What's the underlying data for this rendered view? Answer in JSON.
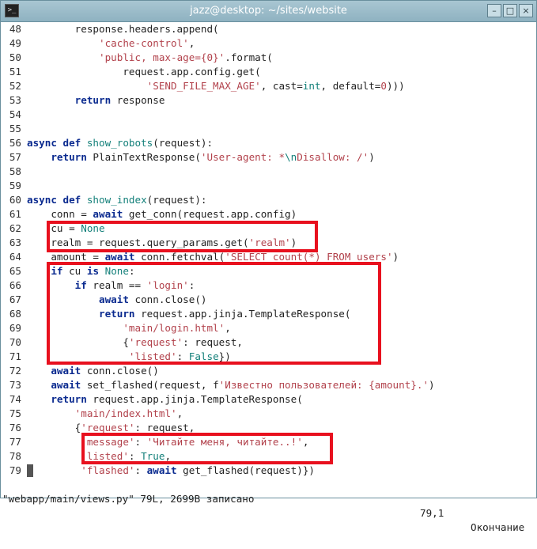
{
  "window": {
    "title": "jazz@desktop: ~/sites/website",
    "app_icon_text": ">_",
    "buttons": {
      "minimize": "–",
      "maximize": "□",
      "close": "×"
    }
  },
  "lines": [
    {
      "n": "48",
      "tokens": [
        {
          "t": "        response.headers.append("
        }
      ]
    },
    {
      "n": "49",
      "tokens": [
        {
          "t": "            "
        },
        {
          "t": "'cache-control'",
          "c": "str"
        },
        {
          "t": ","
        }
      ]
    },
    {
      "n": "50",
      "tokens": [
        {
          "t": "            "
        },
        {
          "t": "'public, max-age={0}'",
          "c": "str"
        },
        {
          "t": ".format("
        }
      ]
    },
    {
      "n": "51",
      "tokens": [
        {
          "t": "                request.app.config.get("
        }
      ]
    },
    {
      "n": "52",
      "tokens": [
        {
          "t": "                    "
        },
        {
          "t": "'SEND_FILE_MAX_AGE'",
          "c": "str"
        },
        {
          "t": ", cast="
        },
        {
          "t": "int",
          "c": "const"
        },
        {
          "t": ", default="
        },
        {
          "t": "0",
          "c": "str"
        },
        {
          "t": ")))"
        }
      ]
    },
    {
      "n": "53",
      "tokens": [
        {
          "t": "        "
        },
        {
          "t": "return",
          "c": "kw"
        },
        {
          "t": " response"
        }
      ]
    },
    {
      "n": "54",
      "tokens": []
    },
    {
      "n": "55",
      "tokens": []
    },
    {
      "n": "56",
      "tokens": [
        {
          "t": "async def",
          "c": "kw"
        },
        {
          "t": " "
        },
        {
          "t": "show_robots",
          "c": "fn"
        },
        {
          "t": "(request):"
        }
      ]
    },
    {
      "n": "57",
      "tokens": [
        {
          "t": "    "
        },
        {
          "t": "return",
          "c": "kw"
        },
        {
          "t": " PlainTextResponse("
        },
        {
          "t": "'User-agent: *",
          "c": "str"
        },
        {
          "t": "\\n",
          "c": "const"
        },
        {
          "t": "Disallow: /'",
          "c": "str"
        },
        {
          "t": ")"
        }
      ]
    },
    {
      "n": "58",
      "tokens": []
    },
    {
      "n": "59",
      "tokens": []
    },
    {
      "n": "60",
      "tokens": [
        {
          "t": "async def",
          "c": "kw"
        },
        {
          "t": " "
        },
        {
          "t": "show_index",
          "c": "fn"
        },
        {
          "t": "(request):"
        }
      ]
    },
    {
      "n": "61",
      "tokens": [
        {
          "t": "    conn = "
        },
        {
          "t": "await",
          "c": "kw"
        },
        {
          "t": " get_conn(request.app.config)"
        }
      ]
    },
    {
      "n": "62",
      "tokens": [
        {
          "t": "    cu = "
        },
        {
          "t": "None",
          "c": "const"
        }
      ]
    },
    {
      "n": "63",
      "tokens": [
        {
          "t": "    realm = request.query_params.get("
        },
        {
          "t": "'realm'",
          "c": "str"
        },
        {
          "t": ")"
        }
      ]
    },
    {
      "n": "64",
      "tokens": [
        {
          "t": "    amount = "
        },
        {
          "t": "await",
          "c": "kw"
        },
        {
          "t": " conn.fetchval("
        },
        {
          "t": "'SELECT count(*) FROM users'",
          "c": "str"
        },
        {
          "t": ")"
        }
      ]
    },
    {
      "n": "65",
      "tokens": [
        {
          "t": "    "
        },
        {
          "t": "if",
          "c": "kw"
        },
        {
          "t": " cu "
        },
        {
          "t": "is",
          "c": "kw"
        },
        {
          "t": " "
        },
        {
          "t": "None",
          "c": "const"
        },
        {
          "t": ":"
        }
      ]
    },
    {
      "n": "66",
      "tokens": [
        {
          "t": "        "
        },
        {
          "t": "if",
          "c": "kw"
        },
        {
          "t": " realm == "
        },
        {
          "t": "'login'",
          "c": "str"
        },
        {
          "t": ":"
        }
      ]
    },
    {
      "n": "67",
      "tokens": [
        {
          "t": "            "
        },
        {
          "t": "await",
          "c": "kw"
        },
        {
          "t": " conn.close()"
        }
      ]
    },
    {
      "n": "68",
      "tokens": [
        {
          "t": "            "
        },
        {
          "t": "return",
          "c": "kw"
        },
        {
          "t": " request.app.jinja.TemplateResponse("
        }
      ]
    },
    {
      "n": "69",
      "tokens": [
        {
          "t": "                "
        },
        {
          "t": "'main/login.html'",
          "c": "str"
        },
        {
          "t": ","
        }
      ]
    },
    {
      "n": "70",
      "tokens": [
        {
          "t": "                {"
        },
        {
          "t": "'request'",
          "c": "str"
        },
        {
          "t": ": request,"
        }
      ]
    },
    {
      "n": "71",
      "tokens": [
        {
          "t": "                 "
        },
        {
          "t": "'listed'",
          "c": "str"
        },
        {
          "t": ": "
        },
        {
          "t": "False",
          "c": "const"
        },
        {
          "t": "})"
        }
      ]
    },
    {
      "n": "72",
      "tokens": [
        {
          "t": "    "
        },
        {
          "t": "await",
          "c": "kw"
        },
        {
          "t": " conn.close()"
        }
      ]
    },
    {
      "n": "73",
      "tokens": [
        {
          "t": "    "
        },
        {
          "t": "await",
          "c": "kw"
        },
        {
          "t": " set_flashed(request, f"
        },
        {
          "t": "'Известно пользователей: {amount}.'",
          "c": "str"
        },
        {
          "t": ")"
        }
      ]
    },
    {
      "n": "74",
      "tokens": [
        {
          "t": "    "
        },
        {
          "t": "return",
          "c": "kw"
        },
        {
          "t": " request.app.jinja.TemplateResponse("
        }
      ]
    },
    {
      "n": "75",
      "tokens": [
        {
          "t": "        "
        },
        {
          "t": "'main/index.html'",
          "c": "str"
        },
        {
          "t": ","
        }
      ]
    },
    {
      "n": "76",
      "tokens": [
        {
          "t": "        {"
        },
        {
          "t": "'request'",
          "c": "str"
        },
        {
          "t": ": request,"
        }
      ]
    },
    {
      "n": "77",
      "tokens": [
        {
          "t": "         "
        },
        {
          "t": "'message'",
          "c": "str"
        },
        {
          "t": ": "
        },
        {
          "t": "'Читайте меня, читайте..!'",
          "c": "str"
        },
        {
          "t": ","
        }
      ]
    },
    {
      "n": "78",
      "tokens": [
        {
          "t": "         "
        },
        {
          "t": "'listed'",
          "c": "str"
        },
        {
          "t": ": "
        },
        {
          "t": "True",
          "c": "const"
        },
        {
          "t": ","
        }
      ]
    },
    {
      "n": "79",
      "tokens": [
        {
          "t": "         "
        },
        {
          "t": "'flashed'",
          "c": "str"
        },
        {
          "t": ": "
        },
        {
          "t": "await",
          "c": "kw"
        },
        {
          "t": " get_flashed(request)})"
        }
      ]
    }
  ],
  "status": {
    "file": "\"webapp/main/views.py\" 79L, 2699B записано",
    "position": "79,1",
    "mode": "Окончание"
  },
  "colors": {
    "highlight_box": "#e8101e",
    "keyword": "#0a2a8f",
    "string": "#b2424c",
    "function": "#14807a"
  }
}
